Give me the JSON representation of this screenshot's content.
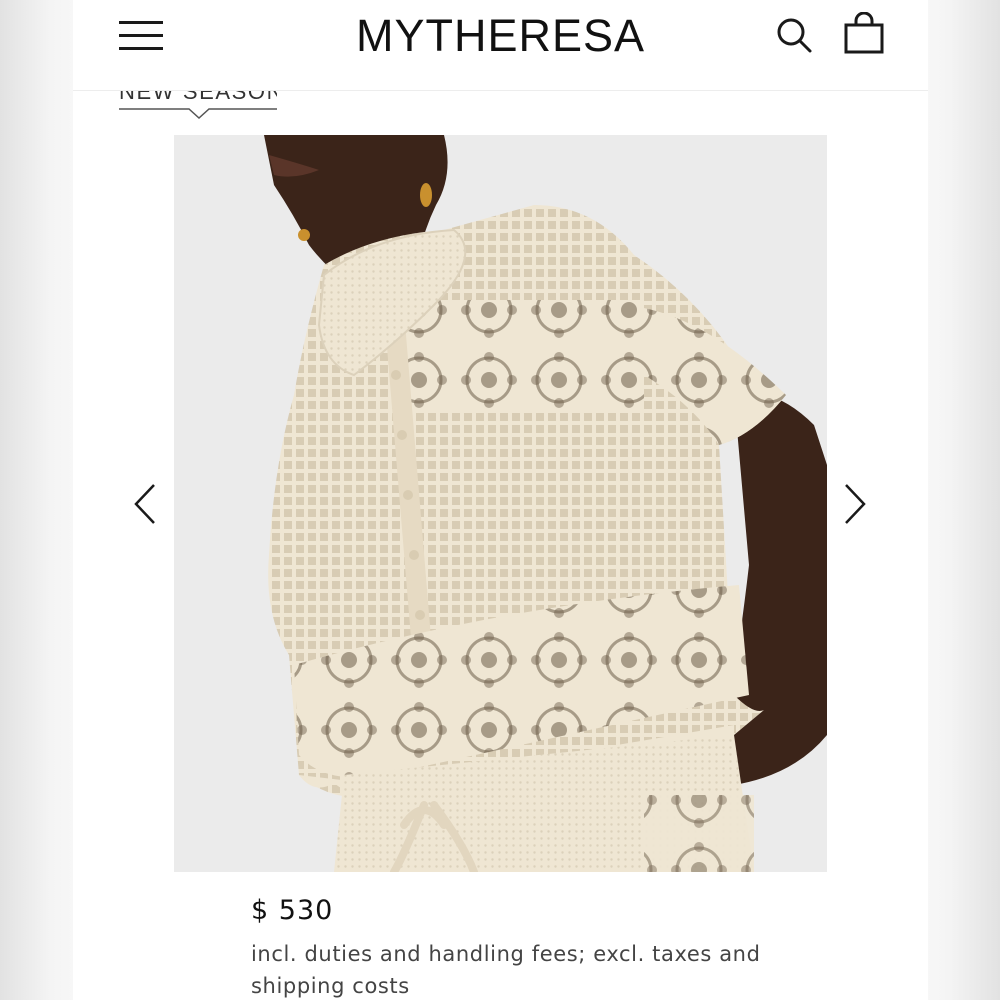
{
  "header": {
    "logo": "MYTHERESA",
    "icons": [
      "menu-icon",
      "search-icon",
      "shopping-bag-icon"
    ]
  },
  "product": {
    "badge": "NEW SEASON",
    "price": "$ 530",
    "price_note": "incl. duties and handling fees; excl. taxes and shipping costs"
  },
  "carousel": {
    "icons": [
      "chevron-left-icon",
      "chevron-right-icon"
    ]
  },
  "colors": {
    "background": "#ffffff",
    "text": "#111111",
    "image_background": "#ebebeb",
    "garment": "#efe6d3"
  }
}
